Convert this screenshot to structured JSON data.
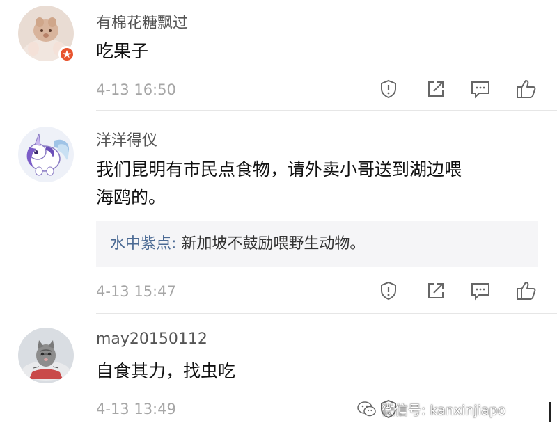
{
  "comments": [
    {
      "username": "有棉花糖飘过",
      "text_lines": [
        "吃果子"
      ],
      "timestamp": "4-13 16:50",
      "avatar_icon": "cat-paw-avatar",
      "has_badge": true
    },
    {
      "username": "洋洋得仪",
      "text_lines": [
        "我们昆明有市民点食物，请外卖小哥送到湖边喂",
        "海鸥的。"
      ],
      "reply": {
        "name": "水中紫点",
        "separator": ": ",
        "text": "新加坡不鼓励喂野生动物。"
      },
      "timestamp": "4-13 15:47",
      "avatar_icon": "unicorn-avatar"
    },
    {
      "username": "may20150112",
      "text_lines": [
        "自食其力，找虫吃"
      ],
      "timestamp": "4-13 13:49",
      "avatar_icon": "kitten-avatar"
    }
  ],
  "actions": [
    "report-icon",
    "share-icon",
    "comment-icon",
    "like-icon"
  ],
  "watermark": {
    "text": "微信号: kanxinjiapo",
    "icon": "wechat-icon"
  },
  "colors": {
    "badge": "#e8542f",
    "reply_name": "#4b6a94",
    "timestamp": "#a6a6a6",
    "reply_bg": "#f5f5f7"
  }
}
